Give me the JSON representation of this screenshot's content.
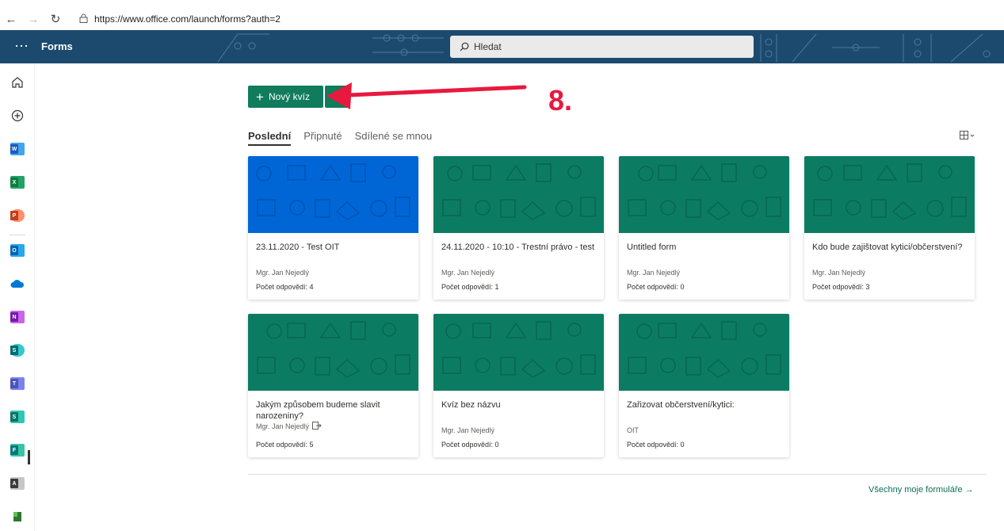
{
  "browser": {
    "url": "https://www.office.com/launch/forms?auth=2",
    "back_icon": "arrow-left-icon",
    "forward_icon": "arrow-right-icon",
    "reload_icon": "reload-icon",
    "lock_icon": "lock-icon"
  },
  "header": {
    "app_name": "Forms",
    "search_placeholder": "Hledat",
    "bg_color": "#1c4a6e"
  },
  "rail": {
    "items": [
      "home-icon",
      "create-icon",
      "word-icon",
      "excel-icon",
      "powerpoint-icon",
      "outlook-icon",
      "onedrive-icon",
      "onenote-icon",
      "sharepoint-icon",
      "teams-icon",
      "sway-icon",
      "forms-icon",
      "admin-icon",
      "planner-icon"
    ]
  },
  "main": {
    "new_button_label": "Nový kvíz",
    "annotation_step": "8.",
    "tabs": [
      "Poslední",
      "Připnuté",
      "Sdílené se mnou"
    ],
    "all_forms_label": "Všechny moje formuláře →",
    "accent_color": "#107c5c",
    "annotation_color": "#e8193e"
  },
  "cards": [
    {
      "title": "23.11.2020 - Test OIT",
      "owner": "Mgr. Jan Nejedlý",
      "responses": "Počet odpovědí: 4",
      "color": "#0066d6"
    },
    {
      "title": "24.11.2020 - 10:10 - Trestní právo - test",
      "owner": "Mgr. Jan Nejedlý",
      "responses": "Počet odpovědí: 1",
      "color": "#0b7c62"
    },
    {
      "title": "Untitled form",
      "owner": "Mgr. Jan Nejedlý",
      "responses": "Počet odpovědí: 0",
      "color": "#0b7c62"
    },
    {
      "title": "Kdo bude zajištovat kytici/občerstvení?",
      "owner": "Mgr. Jan Nejedlý",
      "responses": "Počet odpovědí: 3",
      "color": "#0b7c62"
    },
    {
      "title": "Jakým způsobem budeme slavit narozeniny?",
      "owner": "Mgr. Jan Nejedlý",
      "responses": "Počet odpovědí: 5",
      "color": "#0b7c62",
      "shared": true
    },
    {
      "title": "Kvíz bez názvu",
      "owner": "Mgr. Jan Nejedlý",
      "responses": "Počet odpovědí: 0",
      "color": "#0b7c62"
    },
    {
      "title": "Zařizovat občerstvení/kytici:",
      "owner": "OIT",
      "responses": "Počet odpovědí: 0",
      "color": "#0b7c62"
    }
  ]
}
